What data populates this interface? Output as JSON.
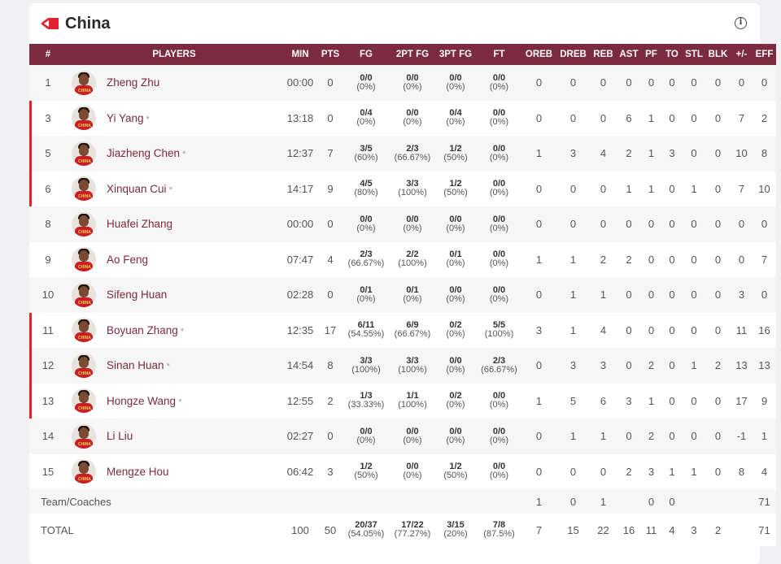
{
  "team": {
    "name": "China",
    "flag_icon": "red-arrow-flag-icon",
    "info_icon": "info-icon"
  },
  "columns": [
    "#",
    "PLAYERS",
    "MIN",
    "PTS",
    "FG",
    "2PT FG",
    "3PT FG",
    "FT",
    "OREB",
    "DREB",
    "REB",
    "AST",
    "PF",
    "TO",
    "STL",
    "BLK",
    "+/-",
    "EFF"
  ],
  "players": [
    {
      "num": "1",
      "name": "Zheng Zhu",
      "starter": false,
      "min": "00:00",
      "pts": "0",
      "fg": [
        "0/0",
        "(0%)"
      ],
      "fg2": [
        "0/0",
        "(0%)"
      ],
      "fg3": [
        "0/0",
        "(0%)"
      ],
      "ft": [
        "0/0",
        "(0%)"
      ],
      "oreb": "0",
      "dreb": "0",
      "reb": "0",
      "ast": "0",
      "pf": "0",
      "to": "0",
      "stl": "0",
      "blk": "0",
      "pm": "0",
      "eff": "0"
    },
    {
      "num": "3",
      "name": "Yi Yang",
      "starter": true,
      "min": "13:18",
      "pts": "0",
      "fg": [
        "0/4",
        "(0%)"
      ],
      "fg2": [
        "0/0",
        "(0%)"
      ],
      "fg3": [
        "0/4",
        "(0%)"
      ],
      "ft": [
        "0/0",
        "(0%)"
      ],
      "oreb": "0",
      "dreb": "0",
      "reb": "0",
      "ast": "6",
      "pf": "1",
      "to": "0",
      "stl": "0",
      "blk": "0",
      "pm": "7",
      "eff": "2"
    },
    {
      "num": "5",
      "name": "Jiazheng Chen",
      "starter": true,
      "min": "12:37",
      "pts": "7",
      "fg": [
        "3/5",
        "(60%)"
      ],
      "fg2": [
        "2/3",
        "(66.67%)"
      ],
      "fg3": [
        "1/2",
        "(50%)"
      ],
      "ft": [
        "0/0",
        "(0%)"
      ],
      "oreb": "1",
      "dreb": "3",
      "reb": "4",
      "ast": "2",
      "pf": "1",
      "to": "3",
      "stl": "0",
      "blk": "0",
      "pm": "10",
      "eff": "8"
    },
    {
      "num": "6",
      "name": "Xinquan Cui",
      "starter": true,
      "min": "14:17",
      "pts": "9",
      "fg": [
        "4/5",
        "(80%)"
      ],
      "fg2": [
        "3/3",
        "(100%)"
      ],
      "fg3": [
        "1/2",
        "(50%)"
      ],
      "ft": [
        "0/0",
        "(0%)"
      ],
      "oreb": "0",
      "dreb": "0",
      "reb": "0",
      "ast": "1",
      "pf": "1",
      "to": "0",
      "stl": "1",
      "blk": "0",
      "pm": "7",
      "eff": "10"
    },
    {
      "num": "8",
      "name": "Huafei Zhang",
      "starter": false,
      "min": "00:00",
      "pts": "0",
      "fg": [
        "0/0",
        "(0%)"
      ],
      "fg2": [
        "0/0",
        "(0%)"
      ],
      "fg3": [
        "0/0",
        "(0%)"
      ],
      "ft": [
        "0/0",
        "(0%)"
      ],
      "oreb": "0",
      "dreb": "0",
      "reb": "0",
      "ast": "0",
      "pf": "0",
      "to": "0",
      "stl": "0",
      "blk": "0",
      "pm": "0",
      "eff": "0"
    },
    {
      "num": "9",
      "name": "Ao Feng",
      "starter": false,
      "min": "07:47",
      "pts": "4",
      "fg": [
        "2/3",
        "(66.67%)"
      ],
      "fg2": [
        "2/2",
        "(100%)"
      ],
      "fg3": [
        "0/1",
        "(0%)"
      ],
      "ft": [
        "0/0",
        "(0%)"
      ],
      "oreb": "1",
      "dreb": "1",
      "reb": "2",
      "ast": "2",
      "pf": "0",
      "to": "0",
      "stl": "0",
      "blk": "0",
      "pm": "0",
      "eff": "7"
    },
    {
      "num": "10",
      "name": "Sifeng Huan",
      "starter": false,
      "min": "02:28",
      "pts": "0",
      "fg": [
        "0/1",
        "(0%)"
      ],
      "fg2": [
        "0/1",
        "(0%)"
      ],
      "fg3": [
        "0/0",
        "(0%)"
      ],
      "ft": [
        "0/0",
        "(0%)"
      ],
      "oreb": "0",
      "dreb": "1",
      "reb": "1",
      "ast": "0",
      "pf": "0",
      "to": "0",
      "stl": "0",
      "blk": "0",
      "pm": "3",
      "eff": "0"
    },
    {
      "num": "11",
      "name": "Boyuan Zhang",
      "starter": true,
      "min": "12:35",
      "pts": "17",
      "fg": [
        "6/11",
        "(54.55%)"
      ],
      "fg2": [
        "6/9",
        "(66.67%)"
      ],
      "fg3": [
        "0/2",
        "(0%)"
      ],
      "ft": [
        "5/5",
        "(100%)"
      ],
      "oreb": "3",
      "dreb": "1",
      "reb": "4",
      "ast": "0",
      "pf": "0",
      "to": "0",
      "stl": "0",
      "blk": "0",
      "pm": "11",
      "eff": "16"
    },
    {
      "num": "12",
      "name": "Sinan Huan",
      "starter": true,
      "min": "14:54",
      "pts": "8",
      "fg": [
        "3/3",
        "(100%)"
      ],
      "fg2": [
        "3/3",
        "(100%)"
      ],
      "fg3": [
        "0/0",
        "(0%)"
      ],
      "ft": [
        "2/3",
        "(66.67%)"
      ],
      "oreb": "0",
      "dreb": "3",
      "reb": "3",
      "ast": "0",
      "pf": "2",
      "to": "0",
      "stl": "1",
      "blk": "2",
      "pm": "13",
      "eff": "13"
    },
    {
      "num": "13",
      "name": "Hongze Wang",
      "starter": true,
      "min": "12:55",
      "pts": "2",
      "fg": [
        "1/3",
        "(33.33%)"
      ],
      "fg2": [
        "1/1",
        "(100%)"
      ],
      "fg3": [
        "0/2",
        "(0%)"
      ],
      "ft": [
        "0/0",
        "(0%)"
      ],
      "oreb": "1",
      "dreb": "5",
      "reb": "6",
      "ast": "3",
      "pf": "1",
      "to": "0",
      "stl": "0",
      "blk": "0",
      "pm": "17",
      "eff": "9"
    },
    {
      "num": "14",
      "name": "Li Liu",
      "starter": false,
      "min": "02:27",
      "pts": "0",
      "fg": [
        "0/0",
        "(0%)"
      ],
      "fg2": [
        "0/0",
        "(0%)"
      ],
      "fg3": [
        "0/0",
        "(0%)"
      ],
      "ft": [
        "0/0",
        "(0%)"
      ],
      "oreb": "0",
      "dreb": "1",
      "reb": "1",
      "ast": "0",
      "pf": "2",
      "to": "0",
      "stl": "0",
      "blk": "0",
      "pm": "-1",
      "eff": "1"
    },
    {
      "num": "15",
      "name": "Mengze Hou",
      "starter": false,
      "min": "06:42",
      "pts": "3",
      "fg": [
        "1/2",
        "(50%)"
      ],
      "fg2": [
        "0/0",
        "(0%)"
      ],
      "fg3": [
        "1/2",
        "(50%)"
      ],
      "ft": [
        "0/0",
        "(0%)"
      ],
      "oreb": "0",
      "dreb": "0",
      "reb": "0",
      "ast": "2",
      "pf": "3",
      "to": "1",
      "stl": "1",
      "blk": "0",
      "pm": "8",
      "eff": "4"
    }
  ],
  "team_coaches": {
    "label": "Team/Coaches",
    "oreb": "1",
    "dreb": "0",
    "reb": "1",
    "pf": "0",
    "to": "0",
    "eff": "71"
  },
  "total": {
    "label": "TOTAL",
    "min": "100",
    "pts": "50",
    "fg": [
      "20/37",
      "(54.05%)"
    ],
    "fg2": [
      "17/22",
      "(77.27%)"
    ],
    "fg3": [
      "3/15",
      "(20%)"
    ],
    "ft": [
      "7/8",
      "(87.5%)"
    ],
    "oreb": "7",
    "dreb": "15",
    "reb": "22",
    "ast": "16",
    "pf": "11",
    "to": "4",
    "stl": "3",
    "blk": "2",
    "pm": "",
    "eff": "71"
  },
  "avatar_jersey_text": "CHINA",
  "starter_marker": "*",
  "colors": {
    "header_bg": "#7b2a3f",
    "accent_red": "#e0232f",
    "player_name": "#7b2a3f",
    "stripe": "#f6f6f6"
  }
}
